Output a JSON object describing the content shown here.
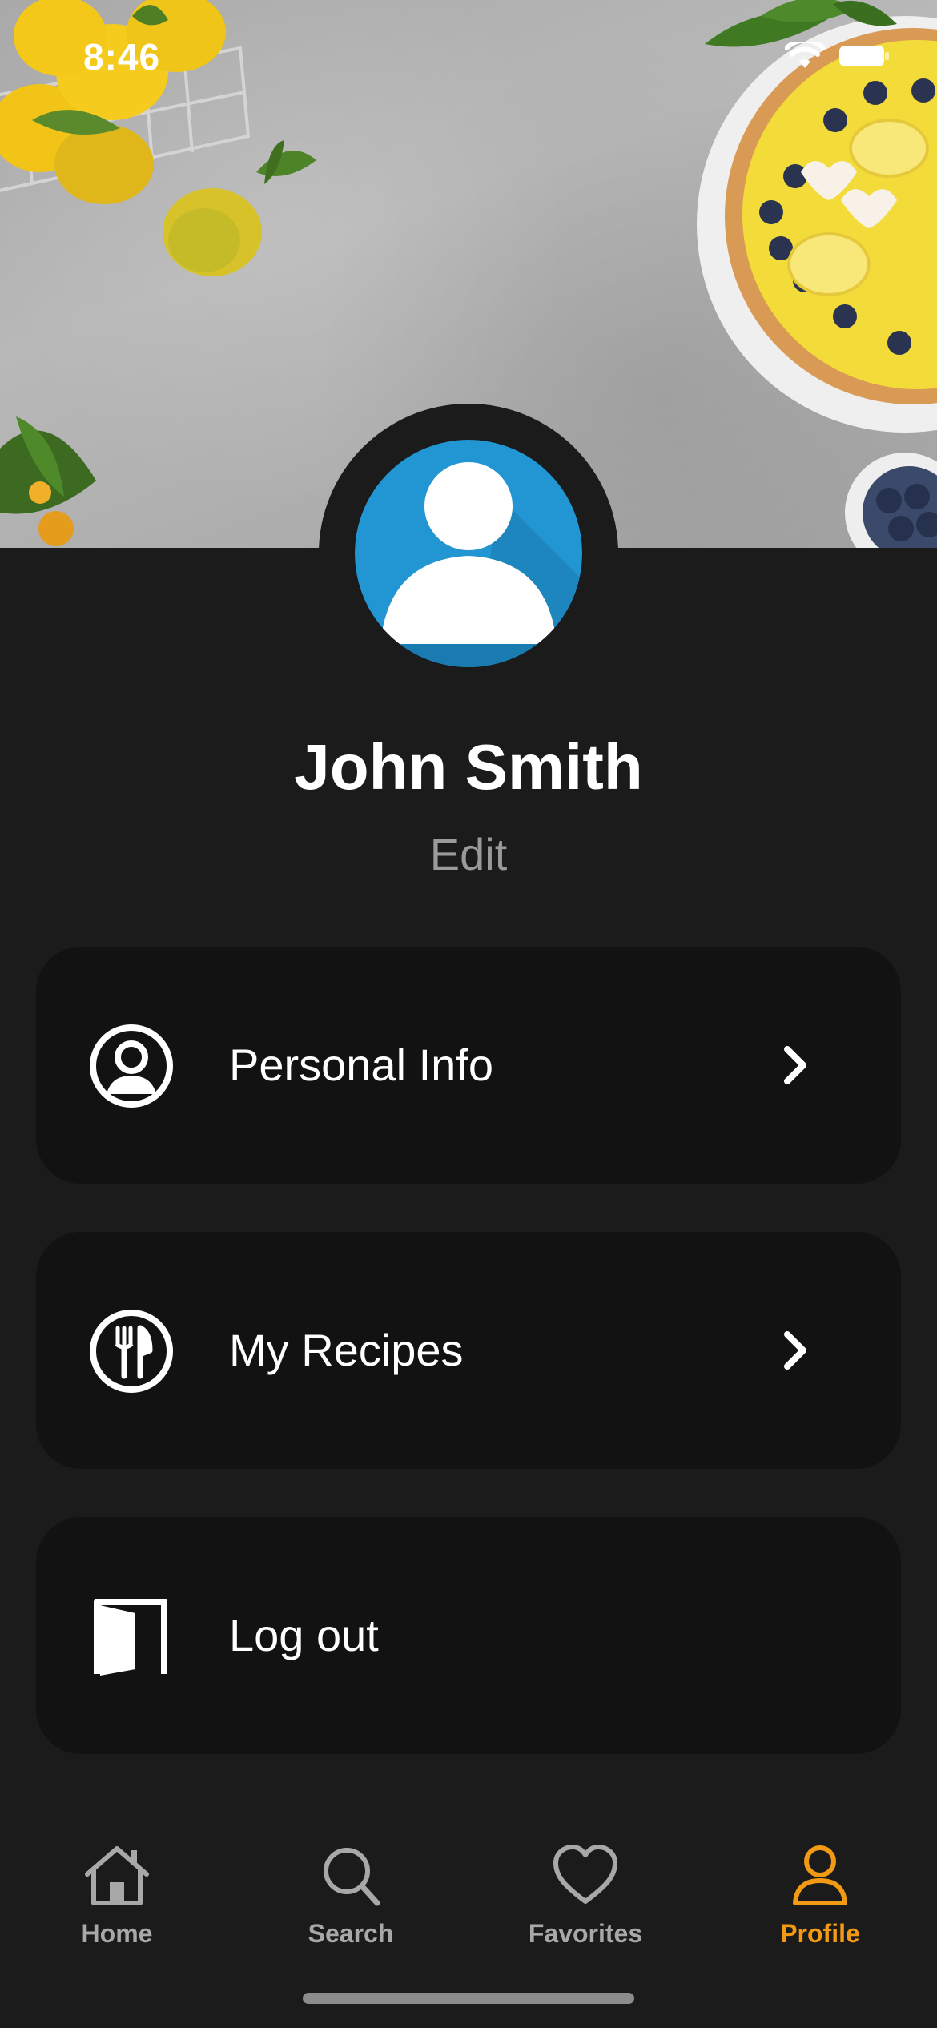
{
  "status_bar": {
    "time": "8:46"
  },
  "profile": {
    "name": "John Smith",
    "edit_label": "Edit"
  },
  "menu": {
    "items": [
      {
        "label": "Personal Info",
        "icon": "user-circle-icon",
        "has_chevron": true
      },
      {
        "label": "My Recipes",
        "icon": "fork-knife-icon",
        "has_chevron": true
      },
      {
        "label": "Log out",
        "icon": "door-icon",
        "has_chevron": false
      }
    ]
  },
  "tabbar": {
    "tabs": [
      {
        "label": "Home",
        "icon": "house-icon",
        "active": false
      },
      {
        "label": "Search",
        "icon": "magnifier-icon",
        "active": false
      },
      {
        "label": "Favorites",
        "icon": "heart-icon",
        "active": false
      },
      {
        "label": "Profile",
        "icon": "person-icon",
        "active": true
      }
    ]
  },
  "colors": {
    "background": "#1b1b1b",
    "card": "#121212",
    "accent": "#f29a14",
    "avatar_blue": "#2196d3",
    "muted_text": "#9a9a9a"
  }
}
